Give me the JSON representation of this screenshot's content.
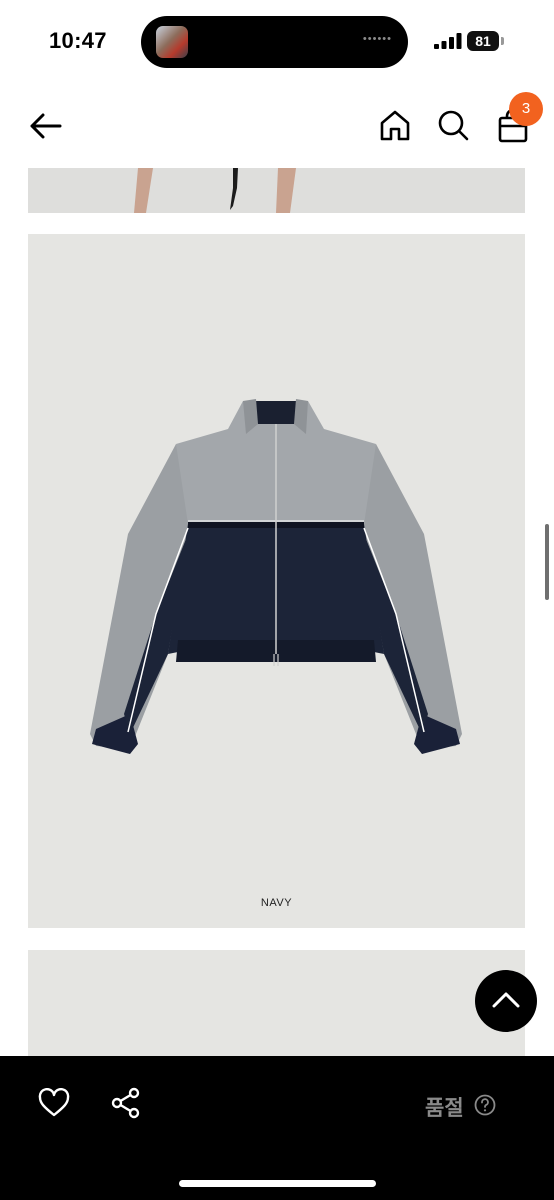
{
  "status_bar": {
    "time": "10:47",
    "battery": "81",
    "island_dots": "••••••"
  },
  "header": {
    "cart_count": "3",
    "icons": [
      "back-arrow-icon",
      "home-icon",
      "search-icon",
      "shopping-bag-icon"
    ]
  },
  "product": {
    "color_label": "NAVY"
  },
  "bottom_bar": {
    "status_label": "품절",
    "icons": [
      "heart-icon",
      "share-icon",
      "help-circle-icon"
    ]
  },
  "colors": {
    "badge": "#f2621f",
    "image_bg": "#e5e5e2",
    "bottom_bar": "#000000",
    "sold_out_text": "#8a8a8a"
  }
}
